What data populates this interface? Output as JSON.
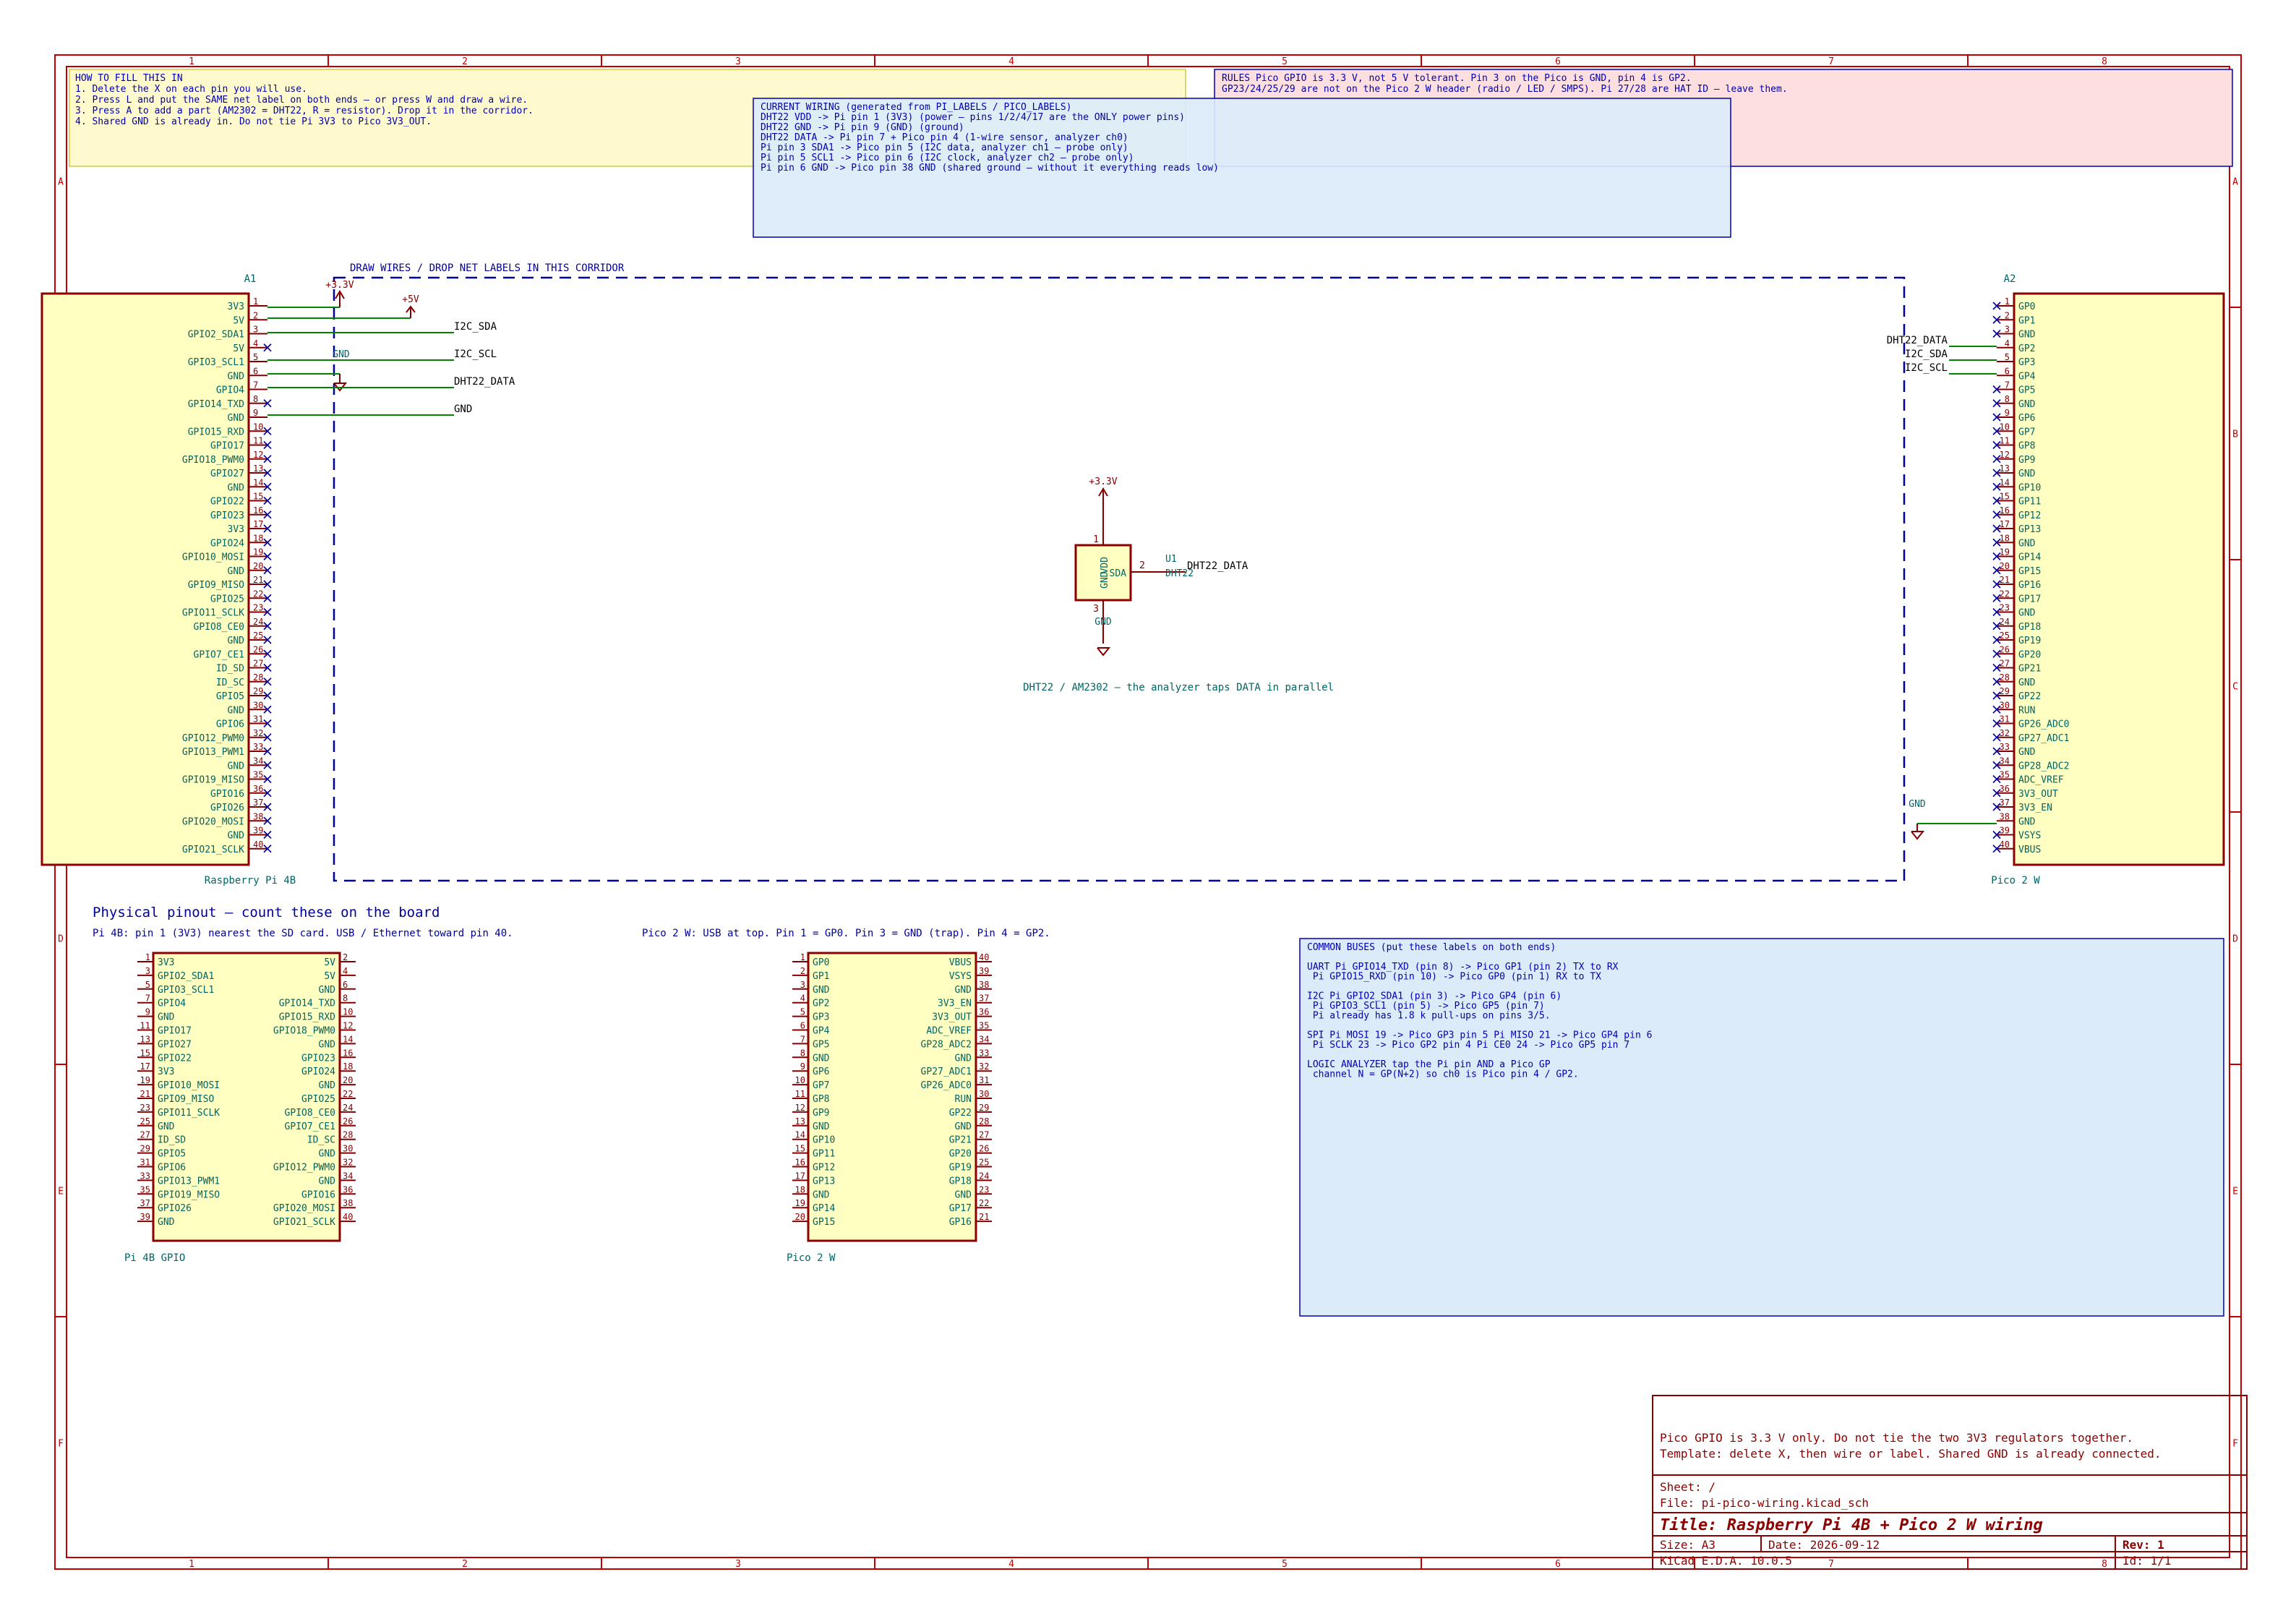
{
  "sheet": {
    "cols": [
      "1",
      "2",
      "3",
      "4",
      "5",
      "6",
      "7",
      "8"
    ],
    "rows": [
      "A",
      "B",
      "C",
      "D",
      "E",
      "F"
    ]
  },
  "colors": {
    "border": "#c00000",
    "component": "#8b0000",
    "fill": "#ffffc2",
    "pin": "#840000",
    "text": "#006464",
    "wire": "#008400",
    "net": "#000000",
    "power": "#840000",
    "corridor": "#00009c",
    "note_yellow_bg": "#fffacd",
    "note_red_bg": "#fddfe0",
    "note_blue_bg": "#dcebfa",
    "note_text": "#0000b0",
    "nc": "#0000a0"
  },
  "notes": {
    "howto": [
      "HOW TO FILL THIS IN",
      "1. Delete the X on each pin you will use.",
      "2. Press L and put the SAME net label on both ends — or press W and draw a wire.",
      "3. Press A to add a part (AM2302 = DHT22, R = resistor). Drop it in the corridor.",
      "4. Shared GND is already in. Do not tie Pi 3V3 to Pico 3V3_OUT."
    ],
    "rules": [
      "RULES   Pico GPIO is 3.3 V, not 5 V tolerant.   Pin 3 on the Pico is GND, pin 4 is GP2.",
      "GP23/24/25/29 are not on the Pico 2 W header (radio / LED / SMPS).   Pi 27/28 are HAT ID — leave them."
    ],
    "current": [
      "CURRENT WIRING (generated from PI_LABELS / PICO_LABELS)",
      "DHT22 VDD   ->   Pi pin 1 (3V3)    (power — pins 1/2/4/17 are the ONLY power pins)",
      "DHT22 GND   ->   Pi pin 9 (GND)    (ground)",
      "DHT22 DATA   ->   Pi pin 7 + Pico pin 4   (1-wire sensor, analyzer ch0)",
      "Pi pin 3 SDA1   ->   Pico pin 5    (I2C data, analyzer ch1 — probe only)",
      "Pi pin 5 SCL1   ->   Pico pin 6    (I2C clock, analyzer ch2 — probe only)",
      "Pi pin 6 GND   ->   Pico pin 38 GND    (shared ground — without it everything reads low)"
    ],
    "buses": [
      "COMMON BUSES (put these labels on both ends)",
      "",
      "UART   Pi GPIO14_TXD (pin 8)   ->   Pico GP1 (pin 2)    TX to RX",
      "       Pi GPIO15_RXD (pin 10)  ->   Pico GP0 (pin 1)    RX to TX",
      "",
      "I2C    Pi GPIO2_SDA1 (pin 3)   ->   Pico GP4 (pin 6)",
      "       Pi GPIO3_SCL1 (pin 5)   ->   Pico GP5 (pin 7)",
      "       Pi already has 1.8 k pull-ups on pins 3/5.",
      "",
      "SPI    Pi MOSI 19 -> Pico GP3 pin 5      Pi MISO 21 -> Pico GP4 pin 6",
      "       Pi SCLK 23 -> Pico GP2 pin 4      Pi CE0  24 -> Pico GP5 pin 7",
      "",
      "LOGIC ANALYZER   tap the Pi pin AND a Pico GP",
      "       channel N = GP(N+2) so ch0 is Pico pin 4 / GP2."
    ]
  },
  "corridor": {
    "label": "DRAW WIRES / DROP NET LABELS IN THIS CORRIDOR"
  },
  "a1": {
    "ref": "A1",
    "value": "Raspberry Pi 4B",
    "pins": [
      "3V3",
      "5V",
      "GPIO2_SDA1",
      "5V",
      "GPIO3_SCL1",
      "GND",
      "GPIO4",
      "GPIO14_TXD",
      "GND",
      "GPIO15_RXD",
      "GPIO17",
      "GPIO18_PWM0",
      "GPIO27",
      "GND",
      "GPIO22",
      "GPIO23",
      "3V3",
      "GPIO24",
      "GPIO10_MOSI",
      "GND",
      "GPIO9_MISO",
      "GPIO25",
      "GPIO11_SCLK",
      "GPIO8_CE0",
      "GND",
      "GPIO7_CE1",
      "ID_SD",
      "ID_SC",
      "GPIO5",
      "GND",
      "GPIO6",
      "GPIO12_PWM0",
      "GPIO13_PWM1",
      "GND",
      "GPIO19_MISO",
      "GPIO16",
      "GPIO26",
      "GPIO20_MOSI",
      "GND",
      "GPIO21_SCLK"
    ],
    "used": [
      1,
      2,
      3,
      5,
      6,
      7,
      9
    ]
  },
  "a2": {
    "ref": "A2",
    "value": "Pico 2 W",
    "pins": [
      "GP0",
      "GP1",
      "GND",
      "GP2",
      "GP3",
      "GP4",
      "GP5",
      "GND",
      "GP6",
      "GP7",
      "GP8",
      "GP9",
      "GND",
      "GP10",
      "GP11",
      "GP12",
      "GP13",
      "GND",
      "GP14",
      "GP15",
      "GP16",
      "GP17",
      "GND",
      "GP18",
      "GP19",
      "GP20",
      "GP21",
      "GND",
      "GP22",
      "RUN",
      "GP26_ADC0",
      "GP27_ADC1",
      "GND",
      "GP28_ADC2",
      "ADC_VREF",
      "3V3_OUT",
      "3V3_EN",
      "GND",
      "VSYS",
      "VBUS"
    ],
    "used": [
      4,
      5,
      6,
      38
    ]
  },
  "nets": {
    "i2c_sda": "I2C_SDA",
    "i2c_scl": "I2C_SCL",
    "dht22_data": "DHT22_DATA",
    "gnd": "GND",
    "p3v3": "+3.3V",
    "p5v": "+5V"
  },
  "u1": {
    "ref": "U1",
    "value": "DHT22",
    "pin_vdd": "VDD",
    "pin_gnd": "GND",
    "pin_sda": "SDA",
    "num_vdd": "1",
    "num_sda": "2",
    "num_gnd": "3",
    "caption": "DHT22 / AM2302 — the analyzer taps DATA in parallel"
  },
  "pinout": {
    "heading": "Physical pinout — count these on the board",
    "pi_caption": "Pi 4B: pin 1 (3V3) nearest the SD card. USB / Ethernet toward pin 40.",
    "pico_caption": "Pico 2 W: USB at top. Pin 1 = GP0. Pin 3 = GND (trap). Pin 4 = GP2.",
    "pi_value": "Pi 4B GPIO",
    "pico_value": "Pico 2 W",
    "pi_left": [
      "3V3",
      "GPIO2_SDA1",
      "GPIO3_SCL1",
      "GPIO4",
      "GND",
      "GPIO17",
      "GPIO27",
      "GPIO22",
      "3V3",
      "GPIO10_MOSI",
      "GPIO9_MISO",
      "GPIO11_SCLK",
      "GND",
      "ID_SD",
      "GPIO5",
      "GPIO6",
      "GPIO13_PWM1",
      "GPIO19_MISO",
      "GPIO26",
      "GND"
    ],
    "pi_right": [
      "5V",
      "5V",
      "GND",
      "GPIO14_TXD",
      "GPIO15_RXD",
      "GPIO18_PWM0",
      "GND",
      "GPIO23",
      "GPIO24",
      "GND",
      "GPIO25",
      "GPIO8_CE0",
      "GPIO7_CE1",
      "ID_SC",
      "GND",
      "GPIO12_PWM0",
      "GND",
      "GPIO16",
      "GPIO20_MOSI",
      "GPIO21_SCLK"
    ],
    "pico_left": [
      "GP0",
      "GP1",
      "GND",
      "GP2",
      "GP3",
      "GP4",
      "GP5",
      "GND",
      "GP6",
      "GP7",
      "GP8",
      "GP9",
      "GND",
      "GP10",
      "GP11",
      "GP12",
      "GP13",
      "GND",
      "GP14",
      "GP15"
    ],
    "pico_right": [
      "VBUS",
      "VSYS",
      "GND",
      "3V3_EN",
      "3V3_OUT",
      "ADC_VREF",
      "GP28_ADC2",
      "GND",
      "GP27_ADC1",
      "GP26_ADC0",
      "RUN",
      "GP22",
      "GND",
      "GP21",
      "GP20",
      "GP19",
      "GP18",
      "GND",
      "GP17",
      "GP16"
    ]
  },
  "title_block": {
    "comment1": "Pico GPIO is 3.3 V only. Do not tie the two 3V3 regulators together.",
    "comment2": "Template: delete X, then wire or label. Shared GND is already connected.",
    "sheet": "Sheet: /",
    "file": "File: pi-pico-wiring.kicad_sch",
    "title": "Title: Raspberry Pi 4B + Pico 2 W wiring",
    "size": "Size: A3",
    "date": "Date: 2026-09-12",
    "rev": "Rev: 1",
    "tool": "KiCad E.D.A. 10.0.5",
    "id": "Id: 1/1"
  }
}
